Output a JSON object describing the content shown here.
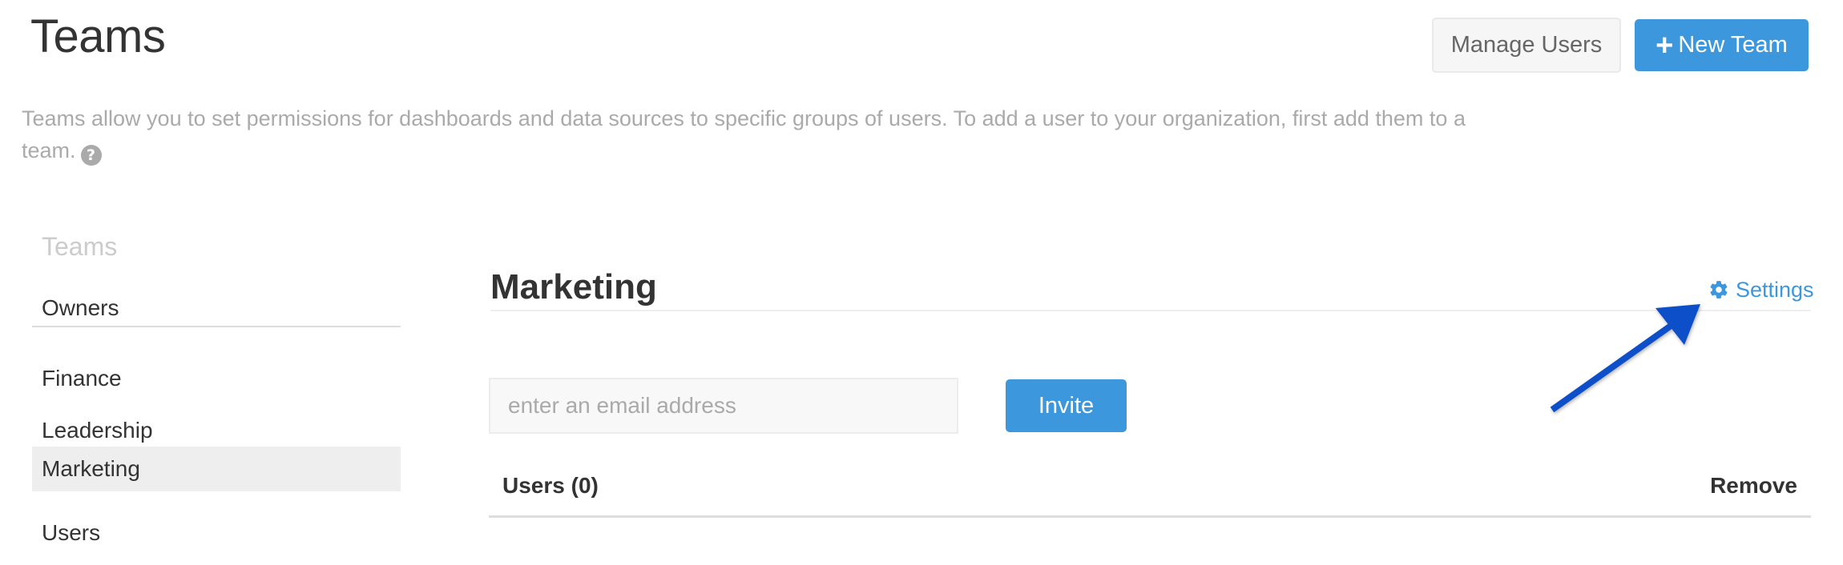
{
  "header": {
    "title": "Teams",
    "manage_users_label": "Manage Users",
    "new_team_icon": "plus-icon",
    "new_team_label": "New Team",
    "description": "Teams allow you to set permissions for dashboards and data sources to specific groups of users. To add a user to your organization, first add them to a team.",
    "help_icon": "question-circle-icon",
    "help_glyph": "?"
  },
  "sidebar": {
    "header": "Teams",
    "pinned_items": [
      {
        "label": "Owners",
        "active": false
      }
    ],
    "items": [
      {
        "label": "Finance",
        "active": false
      },
      {
        "label": "Leadership",
        "active": false
      },
      {
        "label": "Marketing",
        "active": true
      },
      {
        "label": "Users",
        "active": false
      }
    ]
  },
  "team": {
    "name": "Marketing",
    "settings_icon": "gear-icon",
    "settings_label": "Settings",
    "invite": {
      "placeholder": "enter an email address",
      "value": "",
      "button_label": "Invite"
    },
    "users_table": {
      "columns": [
        "Users (0)",
        "Remove"
      ],
      "rows": []
    }
  },
  "annotation": {
    "type": "arrow",
    "points_to": "settings-link",
    "color": "#0a4fc9"
  },
  "colors": {
    "primary": "#3d97dc",
    "active_row": "#eeeeee"
  }
}
